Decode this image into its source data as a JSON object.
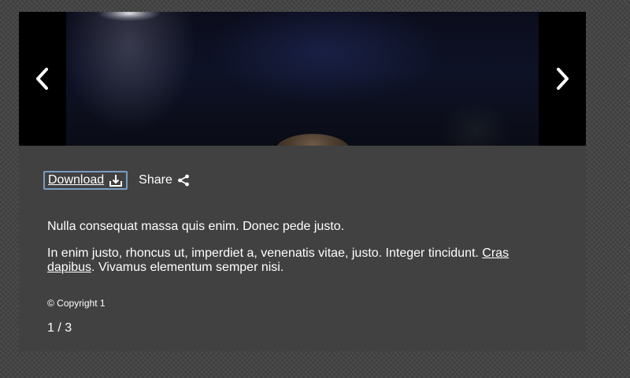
{
  "gallery": {
    "prev_icon": "chevron-left-icon",
    "next_icon": "chevron-right-icon"
  },
  "toolbar": {
    "download_label": "Download",
    "download_icon": "download-icon",
    "share_label": "Share",
    "share_icon": "share-icon"
  },
  "caption": {
    "paragraph1": "Nulla consequat massa quis enim. Donec pede justo.",
    "paragraph2_before": "In enim justo, rhoncus ut, imperdiet a, venenatis vitae, justo. Integer tincidunt. ",
    "paragraph2_link": "Cras dapibus",
    "paragraph2_after": ". Vivamus elementum semper nisi."
  },
  "copyright": "© Copyright 1",
  "counter": "1 / 3",
  "colors": {
    "panel": "#414141",
    "focus_ring": "#7a9cbf",
    "text": "#ffffff"
  }
}
